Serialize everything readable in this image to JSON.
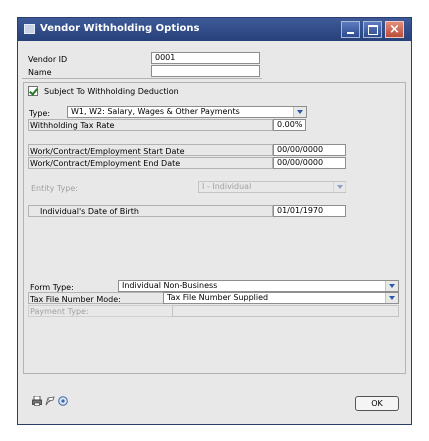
{
  "window": {
    "title": "Vendor Withholding Options"
  },
  "vendor": {
    "id_label": "Vendor ID",
    "id_value": "0001",
    "name_label": "Name",
    "name_value": ""
  },
  "subject": {
    "label": "Subject To Withholding Deduction",
    "checked": true
  },
  "type": {
    "label": "Type:",
    "value": "W1, W2: Salary, Wages & Other Payments"
  },
  "rate": {
    "label": "Withholding Tax Rate",
    "value": "0.00%"
  },
  "dates": {
    "start_label": "Work/Contract/Employment Start Date",
    "start_value": "00/00/0000",
    "end_label": "Work/Contract/Employment End Date",
    "end_value": "00/00/0000"
  },
  "entity": {
    "label": "Entity Type:",
    "value": "I - Individual"
  },
  "birth": {
    "label": "Individual's Date of Birth",
    "value": "01/01/1970"
  },
  "form": {
    "label": "Form Type:",
    "value": "Individual Non-Business"
  },
  "taxfile": {
    "label": "Tax File Number Mode:",
    "value": "Tax File Number Supplied"
  },
  "payment": {
    "label": "Payment Type:",
    "value": ""
  },
  "footer": {
    "icons": [
      "printer-icon",
      "note-icon",
      "help-icon"
    ],
    "ok_label": "OK"
  }
}
